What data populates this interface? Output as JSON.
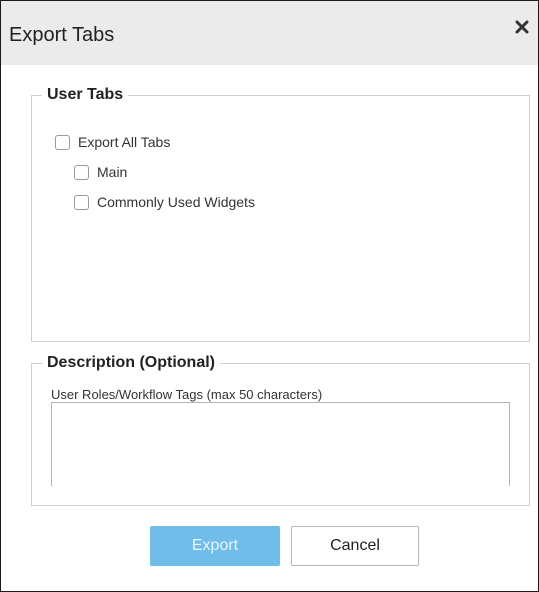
{
  "dialog": {
    "title": "Export Tabs",
    "close_icon": "close-icon"
  },
  "user_tabs": {
    "legend": "User Tabs",
    "export_all_label": "Export All Tabs",
    "export_all_checked": false,
    "tabs": [
      {
        "label": "Main",
        "checked": false
      },
      {
        "label": "Commonly Used Widgets",
        "checked": false
      }
    ]
  },
  "description": {
    "legend": "Description (Optional)",
    "field_label": "User Roles/Workflow Tags (max 50 characters)",
    "value": ""
  },
  "buttons": {
    "export_label": "Export",
    "export_enabled": false,
    "cancel_label": "Cancel"
  },
  "colors": {
    "export_button": "#6fbde8",
    "titlebar": "#ebebeb"
  }
}
